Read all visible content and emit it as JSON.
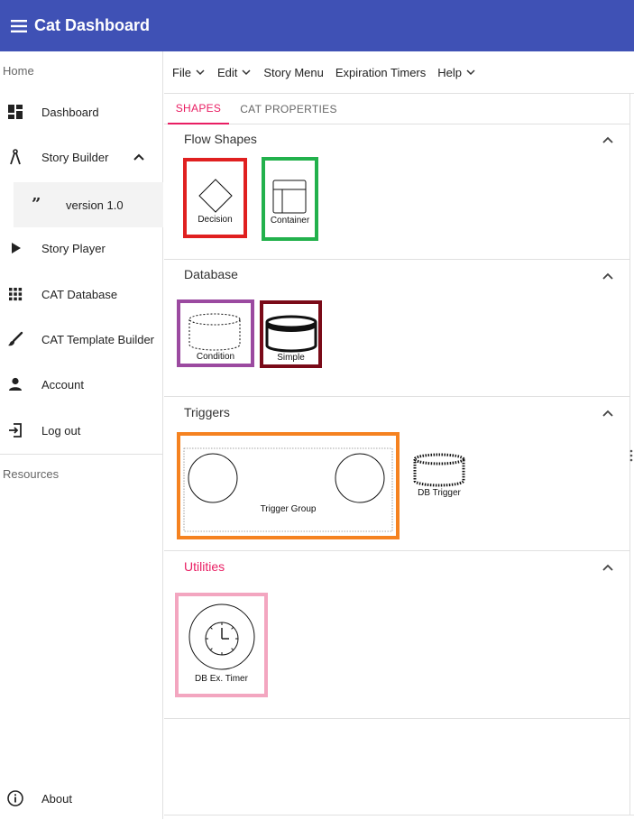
{
  "app": {
    "title": "Cat Dashboard"
  },
  "sidebar": {
    "home_label": "Home",
    "items": [
      {
        "label": "Dashboard",
        "icon": "dashboard-icon"
      },
      {
        "label": "Story Builder",
        "icon": "compass-icon",
        "expanded": true
      },
      {
        "label": "Story Player",
        "icon": "play-icon"
      },
      {
        "label": "CAT Database",
        "icon": "grid-icon"
      },
      {
        "label": "CAT Template Builder",
        "icon": "brush-icon"
      },
      {
        "label": "Account",
        "icon": "person-icon"
      },
      {
        "label": "Log out",
        "icon": "logout-icon"
      }
    ],
    "sub_items": [
      {
        "label": "version 1.0",
        "icon": "quote-icon"
      }
    ],
    "resources_label": "Resources",
    "about_label": "About"
  },
  "menubar": {
    "items": [
      {
        "label": "File",
        "has_caret": true
      },
      {
        "label": "Edit",
        "has_caret": true
      },
      {
        "label": "Story Menu",
        "has_caret": false
      },
      {
        "label": "Expiration Timers",
        "has_caret": false
      },
      {
        "label": "Help",
        "has_caret": true
      }
    ]
  },
  "tabs": [
    {
      "label": "SHAPES",
      "active": true
    },
    {
      "label": "CAT PROPERTIES",
      "active": false
    }
  ],
  "panels": {
    "flow": {
      "title": "Flow Shapes",
      "shapes": [
        "Decision",
        "Container"
      ]
    },
    "database": {
      "title": "Database",
      "shapes": [
        "Condition",
        "Simple"
      ]
    },
    "triggers": {
      "title": "Triggers",
      "shapes": [
        "Trigger Group",
        "DB Trigger"
      ]
    },
    "utilities": {
      "title": "Utilities",
      "shapes": [
        "DB Ex. Timer"
      ]
    }
  },
  "colors": {
    "appbar": "#3f51b5",
    "accent": "#e91e63",
    "outline_decision": "#e02020",
    "outline_container": "#22b14c",
    "outline_condition": "#9b4aa0",
    "outline_simple": "#7a0a18",
    "outline_trigger_group": "#f58220",
    "outline_timer": "#f3a6c0"
  }
}
